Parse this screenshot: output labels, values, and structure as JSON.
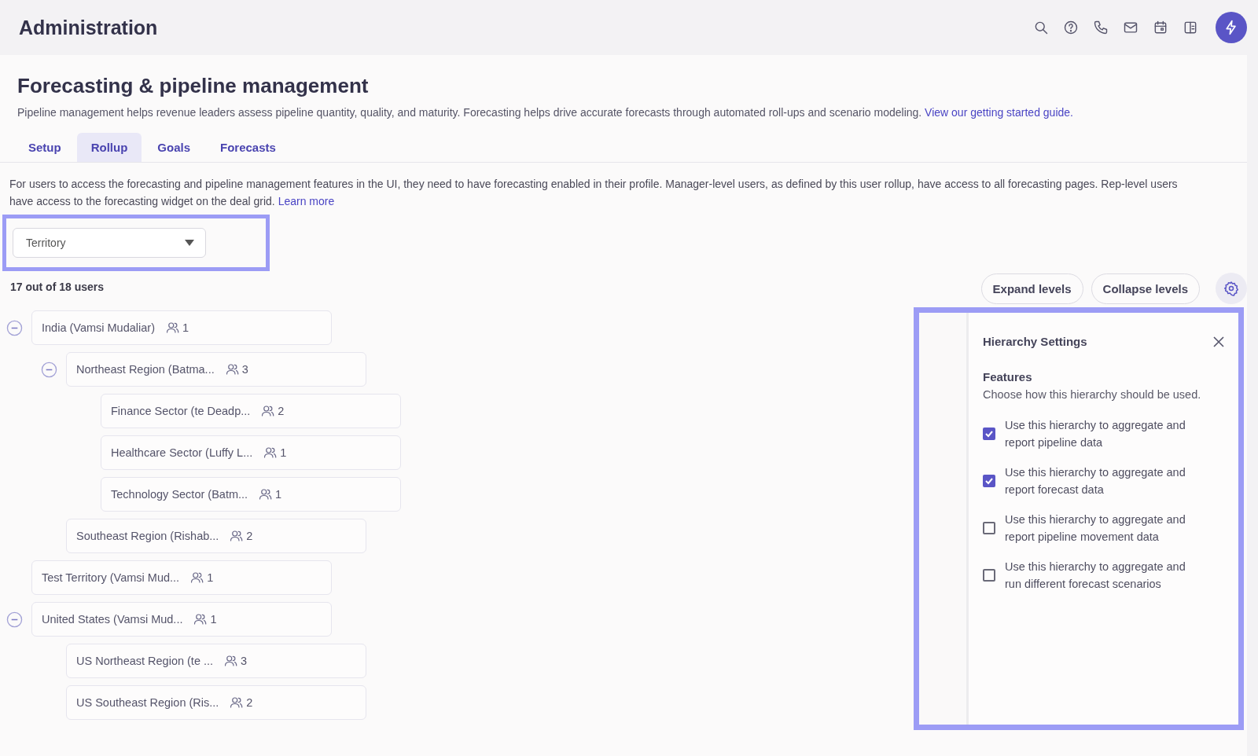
{
  "header": {
    "title": "Administration"
  },
  "page": {
    "title": "Forecasting & pipeline management",
    "description": "Pipeline management helps revenue leaders assess pipeline quantity, quality, and maturity. Forecasting helps drive accurate forecasts through automated roll-ups and scenario modeling.",
    "guide_link": "View our getting started guide."
  },
  "tabs": [
    {
      "label": "Setup",
      "selected": false
    },
    {
      "label": "Rollup",
      "selected": true
    },
    {
      "label": "Goals",
      "selected": false
    },
    {
      "label": "Forecasts",
      "selected": false
    }
  ],
  "rollup": {
    "intro": "For users to access the forecasting and pipeline management features in the UI, they need to have forecasting enabled in their profile. Manager-level users, as defined by this user rollup, have access to all forecasting pages. Rep-level users have access to the forecasting widget on the deal grid.",
    "learn_more": "Learn more",
    "hierarchy_select": {
      "value": "Territory"
    },
    "user_count": "17 out of 18 users",
    "buttons": [
      "Expand levels",
      "Collapse levels"
    ],
    "tree": [
      {
        "label": "India (Vamsi Mudaliar)",
        "count": "1",
        "expanded": true,
        "children": [
          {
            "label": "Northeast Region (Batma...",
            "count": "3",
            "expanded": true,
            "children": [
              {
                "label": "Finance Sector (te Deadp...",
                "count": "2"
              },
              {
                "label": "Healthcare Sector (Luffy L...",
                "count": "1"
              },
              {
                "label": "Technology Sector (Batm...",
                "count": "1"
              }
            ]
          },
          {
            "label": "Southeast Region (Rishab...",
            "count": "2"
          }
        ]
      },
      {
        "label": "Test Territory (Vamsi Mud...",
        "count": "1"
      },
      {
        "label": "United States (Vamsi Mud...",
        "count": "1",
        "expanded": true,
        "children": [
          {
            "label": "US Northeast Region (te ...",
            "count": "3"
          },
          {
            "label": "US Southeast Region (Ris...",
            "count": "2"
          }
        ]
      }
    ]
  },
  "settings_panel": {
    "title": "Hierarchy Settings",
    "section_title": "Features",
    "section_hint": "Choose how this hierarchy should be used.",
    "options": [
      {
        "label": "Use this hierarchy to aggregate and report pipeline data",
        "checked": true
      },
      {
        "label": "Use this hierarchy to aggregate and report forecast data",
        "checked": true
      },
      {
        "label": "Use this hierarchy to aggregate and report pipeline movement data",
        "checked": false
      },
      {
        "label": "Use this hierarchy to aggregate and run different forecast scenarios",
        "checked": false
      }
    ]
  }
}
